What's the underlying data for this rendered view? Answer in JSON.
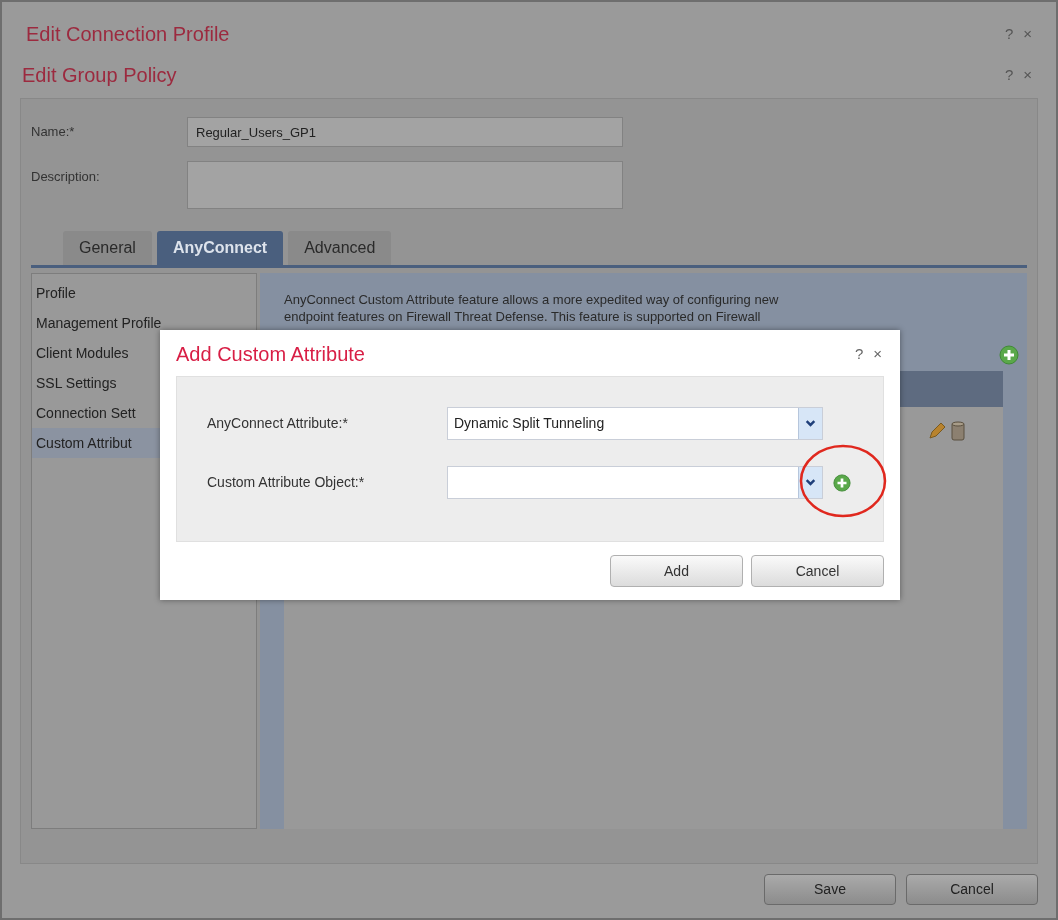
{
  "outer_window": {
    "title": "Edit Connection Profile",
    "help": "?",
    "close": "×"
  },
  "group_policy": {
    "title": "Edit Group Policy",
    "help": "?",
    "close": "×",
    "name": {
      "label": "Name:*",
      "value": "Regular_Users_GP1"
    },
    "description": {
      "label": "Description:"
    },
    "tabs": [
      {
        "label": "General",
        "selected": false
      },
      {
        "label": "AnyConnect",
        "selected": true
      },
      {
        "label": "Advanced",
        "selected": false
      }
    ],
    "sidebar": {
      "items": [
        {
          "label": "Profile",
          "selected": false
        },
        {
          "label": "Management Profile",
          "selected": false
        },
        {
          "label": "Client Modules",
          "selected": false
        },
        {
          "label": "SSL Settings",
          "selected": false
        },
        {
          "label": "Connection Sett",
          "selected": false
        },
        {
          "label": "Custom Attribut",
          "selected": true
        }
      ]
    },
    "content": {
      "description_lines": [
        "AnyConnect Custom Attribute feature allows a more expedited way of configuring new",
        "endpoint features on Firewall Threat Defense. This feature is supported on Firewall"
      ]
    },
    "buttons": [
      "Save",
      "Cancel"
    ]
  },
  "dialog": {
    "title": "Add Custom Attribute",
    "help": "?",
    "close": "×",
    "fields": [
      {
        "label": "AnyConnect Attribute:*",
        "value": "Dynamic Split Tunneling",
        "add_button": false
      },
      {
        "label": "Custom Attribute Object:*",
        "add_button": true
      }
    ],
    "buttons": [
      "Add",
      "Cancel"
    ]
  }
}
